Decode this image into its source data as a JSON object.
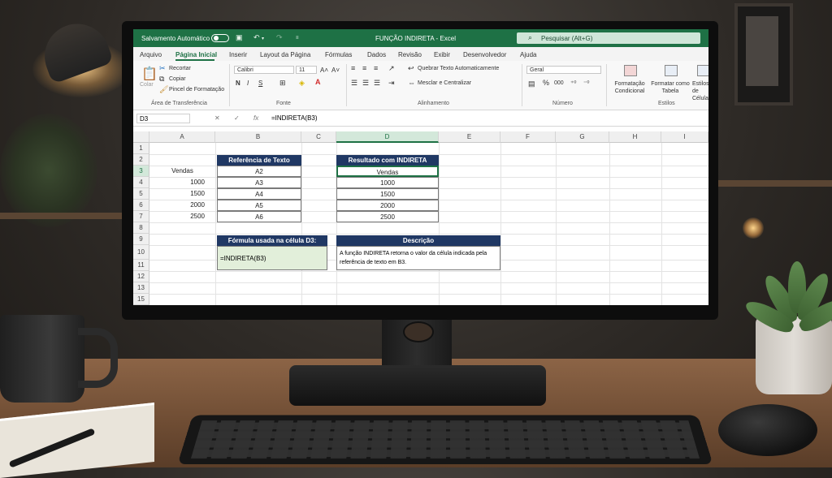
{
  "titlebar": {
    "autosave_label": "Salvamento Automático",
    "document_title": "FUNÇÃO INDIRETA  -  Excel",
    "search_placeholder": "Pesquisar (Alt+G)",
    "accent_color": "#1e7145"
  },
  "menu": {
    "tabs": [
      "Arquivo",
      "Página Inicial",
      "Inserir",
      "Layout da Página",
      "Fórmulas",
      "Dados",
      "Revisão",
      "Exibir",
      "Desenvolvedor",
      "Ajuda"
    ],
    "active": "Página Inicial"
  },
  "ribbon": {
    "clipboard": {
      "paste": "Colar",
      "cut": "Recortar",
      "copy": "Copiar",
      "format_painter": "Pincel de Formatação",
      "group_label": "Área de Transferência"
    },
    "font": {
      "font_name": "Calibri",
      "font_size": "11",
      "bold": "N",
      "italic": "I",
      "underline": "S",
      "group_label": "Fonte"
    },
    "alignment": {
      "wrap_text": "Quebrar Texto Automaticamente",
      "merge_center": "Mesclar e Centralizar",
      "group_label": "Alinhamento"
    },
    "number": {
      "format": "Geral",
      "percent": "%",
      "comma": "000",
      "group_label": "Número"
    },
    "styles": {
      "conditional": "Formatação Condicional",
      "format_table": "Formatar como Tabela",
      "cell_styles": "Estilos de Célula",
      "group_label": "Estilos"
    }
  },
  "formula_bar": {
    "name_box": "D3",
    "formula": "=INDIRETA(B3)"
  },
  "sheet": {
    "columns": [
      "A",
      "B",
      "C",
      "D",
      "E",
      "F",
      "G",
      "H",
      "I"
    ],
    "rows": [
      "1",
      "2",
      "3",
      "4",
      "5",
      "6",
      "7",
      "8",
      "9",
      "10",
      "11",
      "12",
      "13",
      "15"
    ],
    "col_a": {
      "header": "Vendas",
      "values": [
        "1000",
        "1500",
        "2000",
        "2500"
      ]
    },
    "ref_table": {
      "header": "Referência de Texto",
      "values": [
        "A2",
        "A3",
        "A4",
        "A5",
        "A6"
      ]
    },
    "result_table": {
      "header": "Resultado com INDIRETA",
      "values": [
        "Vendas",
        "1000",
        "1500",
        "2000",
        "2500"
      ]
    },
    "formula_used": {
      "header": "Fórmula usada na célula D3:",
      "value": "=INDIRETA(B3)"
    },
    "description": {
      "header": "Descrição",
      "text": "A função INDIRETA retorna o valor da célula indicada pela referência de texto em B3."
    }
  }
}
